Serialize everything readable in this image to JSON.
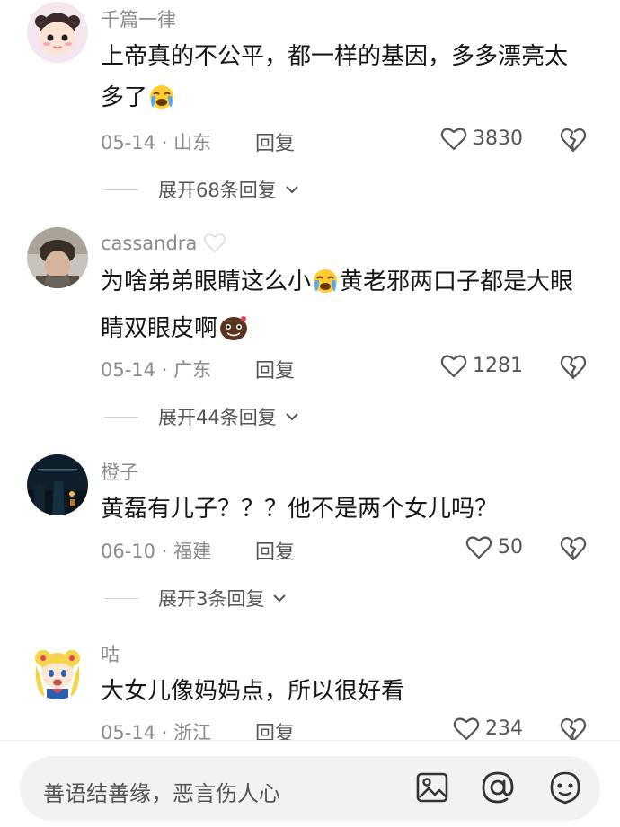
{
  "comments": [
    {
      "username": "千篇一律",
      "text_a": "上帝真的不公平，都一样的基因，多多漂亮太多了",
      "text_b": "",
      "emoji_a": "loudly-crying-face",
      "date": "05-14",
      "location": "山东",
      "reply_label": "回复",
      "likes": "3830",
      "expand_label": "展开68条回复"
    },
    {
      "username": "cassandra",
      "username_suffix_icon": "white-heart",
      "text_a": "为啥弟弟眼睛这么小",
      "text_b": "黄老邪两口子都是大眼睛双眼皮啊",
      "emoji_a": "loudly-crying-face",
      "emoji_b": "brown-face-emoji",
      "date": "05-14",
      "location": "广东",
      "reply_label": "回复",
      "likes": "1281",
      "expand_label": "展开44条回复"
    },
    {
      "username": "橙子",
      "text_a": "黄磊有儿子？？？他不是两个女儿吗？",
      "date": "06-10",
      "location": "福建",
      "reply_label": "回复",
      "likes": "50",
      "expand_label": "展开3条回复"
    },
    {
      "username": "咕",
      "text_a": "大女儿像妈妈点，所以很好看",
      "date": "05-14",
      "location": "浙江",
      "reply_label": "回复",
      "likes": "234"
    }
  ],
  "composer": {
    "placeholder": "善语结善缘，恶言伤人心",
    "icons": [
      "image-icon",
      "at-mention-icon",
      "emoji-icon"
    ]
  },
  "colors": {
    "text_primary": "#161616",
    "text_secondary": "#8a8a8a",
    "input_bg": "#f2f2f2"
  }
}
